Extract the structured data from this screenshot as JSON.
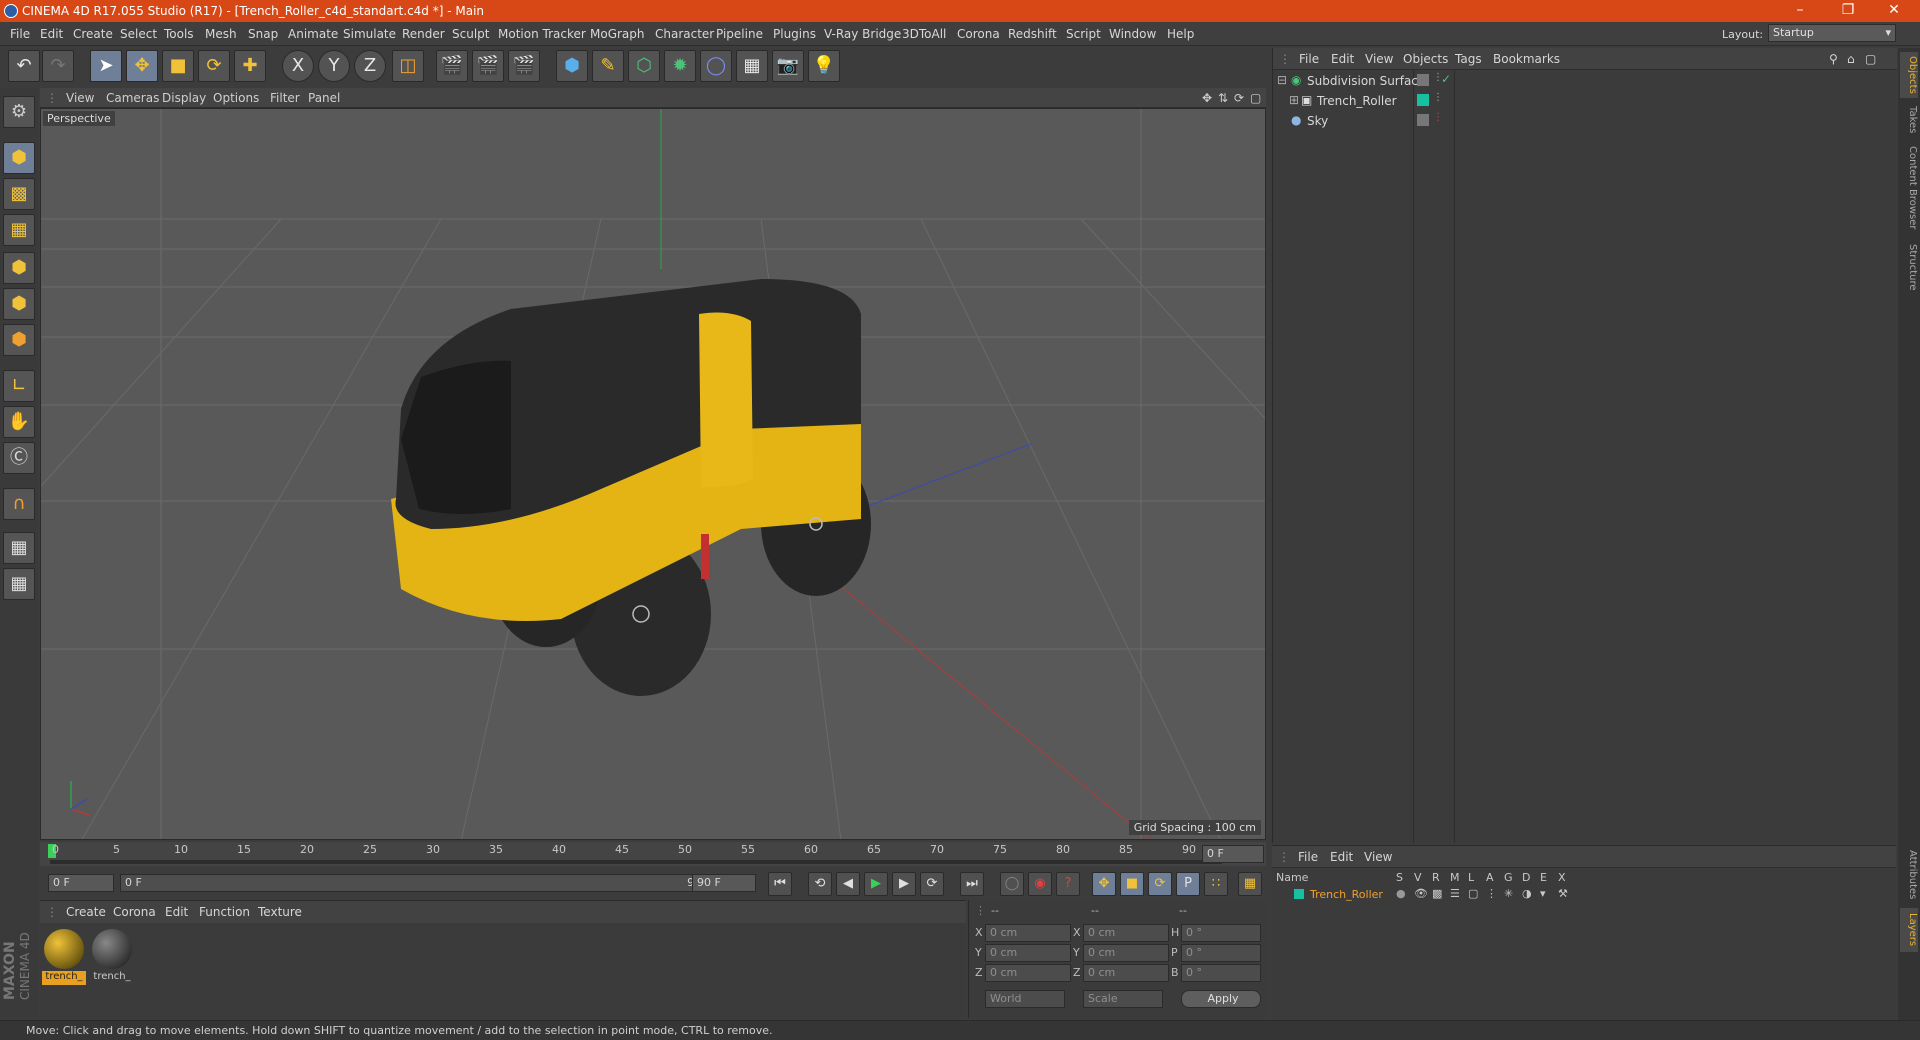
{
  "window": {
    "title": "CINEMA 4D R17.055 Studio (R17) - [Trench_Roller_c4d_standart.c4d *] - Main"
  },
  "menu": [
    "File",
    "Edit",
    "Create",
    "Select",
    "Tools",
    "Mesh",
    "Snap",
    "Animate",
    "Simulate",
    "Render",
    "Sculpt",
    "Motion Tracker",
    "MoGraph",
    "Character",
    "Pipeline",
    "Plugins",
    "V-Ray Bridge",
    "3DToAll",
    "Corona",
    "Redshift",
    "Script",
    "Window",
    "Help"
  ],
  "layout": {
    "label": "Layout:",
    "value": "Startup"
  },
  "toolbar": {
    "x": "X",
    "y": "Y",
    "z": "Z"
  },
  "viewport": {
    "menu": [
      "View",
      "Cameras",
      "Display",
      "Options",
      "Filter",
      "Panel"
    ],
    "name": "Perspective",
    "grid_spacing": "Grid Spacing : 100 cm"
  },
  "objects": {
    "menu": [
      "File",
      "Edit",
      "View",
      "Objects",
      "Tags",
      "Bookmarks"
    ],
    "items": [
      {
        "name": "Subdivision Surface"
      },
      {
        "name": "Trench_Roller"
      },
      {
        "name": "Sky"
      }
    ]
  },
  "side_tabs": [
    "Objects",
    "Takes",
    "Content Browser",
    "Structure"
  ],
  "side_tabs_lower": [
    "Attributes",
    "Layers"
  ],
  "timeline": {
    "ticks": [
      "0",
      "5",
      "10",
      "15",
      "20",
      "25",
      "30",
      "35",
      "40",
      "45",
      "50",
      "55",
      "60",
      "65",
      "70",
      "75",
      "80",
      "85",
      "90"
    ],
    "current": "0 F"
  },
  "transport": {
    "start": "0 F",
    "range_start": "0 F",
    "range_end": "90 F",
    "end": "90 F"
  },
  "materials": {
    "menu": [
      "Create",
      "Corona",
      "Edit",
      "Function",
      "Texture"
    ],
    "items": [
      {
        "name": "trench_"
      },
      {
        "name": "trench_"
      }
    ]
  },
  "coords": {
    "header": [
      "--",
      "--",
      "--"
    ],
    "rows": [
      {
        "a": "X",
        "av": "0 cm",
        "b": "X",
        "bv": "0 cm",
        "c": "H",
        "cv": "0 °"
      },
      {
        "a": "Y",
        "av": "0 cm",
        "b": "Y",
        "bv": "0 cm",
        "c": "P",
        "cv": "0 °"
      },
      {
        "a": "Z",
        "av": "0 cm",
        "b": "Z",
        "bv": "0 cm",
        "c": "B",
        "cv": "0 °"
      }
    ],
    "world": "World",
    "scale": "Scale",
    "apply": "Apply"
  },
  "layers": {
    "menu": [
      "File",
      "Edit",
      "View"
    ],
    "columns": [
      "Name",
      "S",
      "V",
      "R",
      "M",
      "L",
      "A",
      "G",
      "D",
      "E",
      "X"
    ],
    "row": "Trench_Roller"
  },
  "maxon": {
    "brand": "MAXON",
    "product": "CINEMA 4D"
  },
  "status": "Move: Click and drag to move elements. Hold down SHIFT to quantize movement / add to the selection in point mode, CTRL to remove."
}
